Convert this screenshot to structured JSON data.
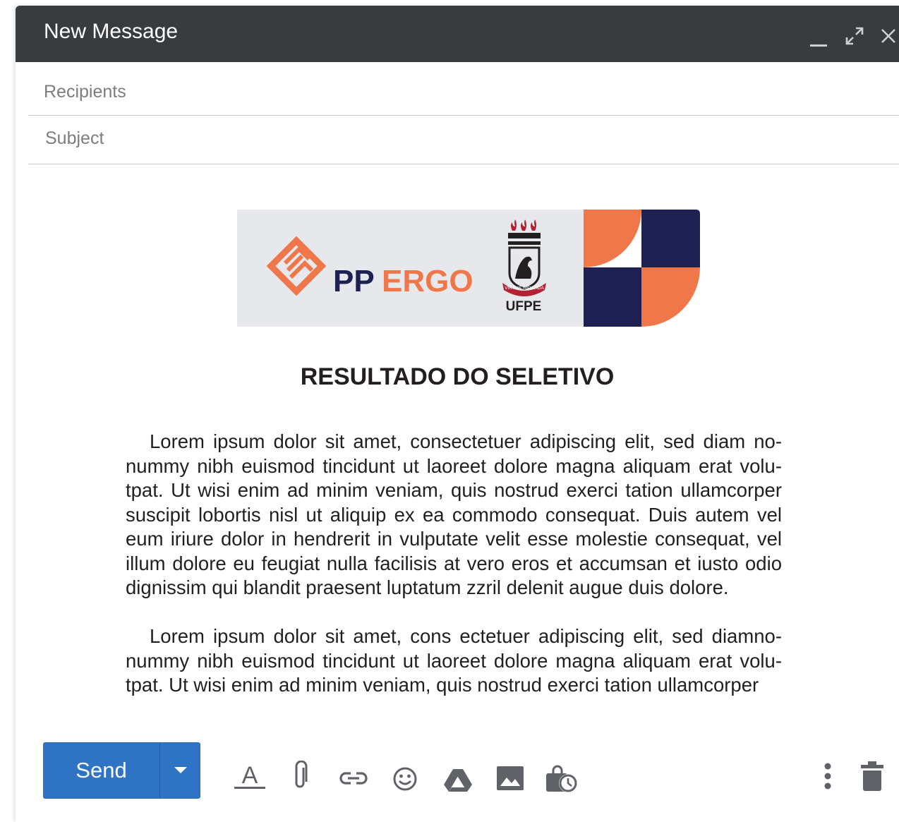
{
  "window": {
    "title": "New Message",
    "controls": [
      "minimize-icon",
      "expand-icon",
      "close-icon"
    ]
  },
  "fields": {
    "recipients_placeholder": "Recipients",
    "subject_placeholder": "Subject"
  },
  "banner": {
    "logo_text_dark": "PP",
    "logo_text_orange": "ERGO",
    "seal_motto": "VIRTUS IMPAVIDA",
    "university": "UFPE",
    "colors": {
      "orange": "#f0774a",
      "navy": "#1f2153",
      "gray": "#e6e8eb"
    }
  },
  "body": {
    "heading": "RESULTADO DO SELETIVO",
    "paragraph_1_lines": [
      "Lorem ipsum dolor sit amet, consectetuer adipiscing elit, sed diam no-",
      "nummy nibh euismod tincidunt ut laoreet dolore magna aliquam erat volu-",
      "tpat. Ut wisi enim ad minim veniam, quis nostrud exerci tation ullamcorper",
      "suscipit lobortis nisl ut aliquip ex ea commodo consequat. Duis autem vel",
      "eum iriure dolor in hendrerit in vulputate velit esse molestie consequat, vel",
      "illum dolore eu feugiat nulla facilisis at vero eros et accumsan et iusto odio",
      "dignissim qui blandit praesent luptatum zzril delenit augue duis dolore."
    ],
    "paragraph_2_lines": [
      "Lorem ipsum dolor sit amet, cons ectetuer adipiscing elit, sed diamno-",
      "nummy nibh euismod tincidunt ut laoreet dolore magna aliquam erat volu-",
      "tpat. Ut wisi enim ad minim veniam, quis nostrud exerci tation ullamcorper"
    ]
  },
  "toolbar": {
    "send_label": "Send",
    "send_color": "#2f73c5",
    "formatting_letter": "A",
    "tools": [
      "format-text-icon",
      "attach-icon",
      "link-icon",
      "emoji-icon",
      "drive-icon",
      "photo-icon",
      "confidential-icon"
    ],
    "right_tools": [
      "more-options-icon",
      "trash-icon"
    ]
  }
}
